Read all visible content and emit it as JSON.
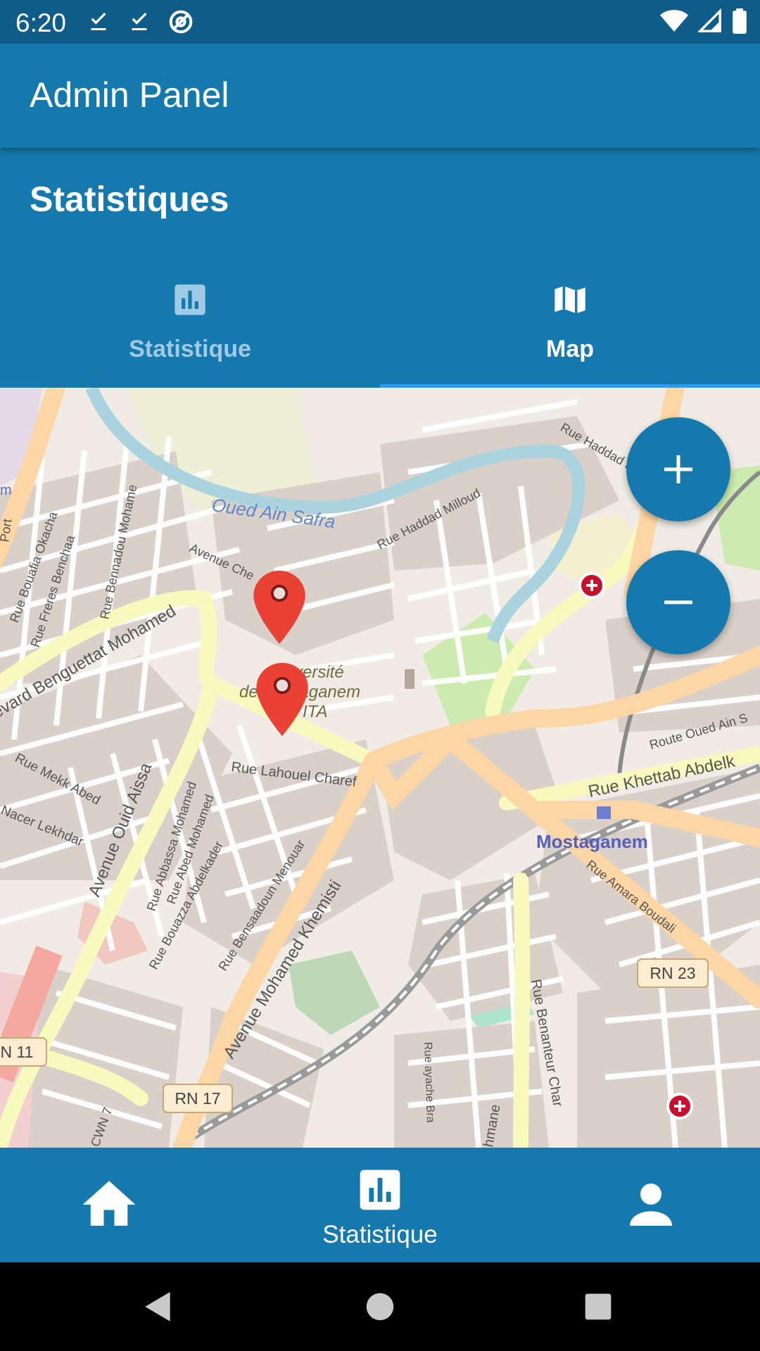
{
  "status_bar": {
    "time": "6:20",
    "left_icons": [
      "download-done-icon",
      "download-done-icon",
      "at-sign-icon"
    ],
    "right_icons": [
      "wifi-icon",
      "cell-signal-icon",
      "battery-icon"
    ]
  },
  "app_bar": {
    "title": "Admin Panel"
  },
  "section": {
    "title": "Statistiques"
  },
  "tabs": [
    {
      "label": "Statistique",
      "icon": "bar-chart-icon",
      "selected": false
    },
    {
      "label": "Map",
      "icon": "map-icon",
      "selected": true
    }
  ],
  "map": {
    "zoom_in_label": "+",
    "zoom_out_label": "−",
    "markers": 2,
    "labels": {
      "river": "Oued Ain Safra",
      "city": "Mostaganem",
      "university_1": "versité",
      "university_2": "de Mostaganem",
      "ita": "ITA",
      "road_rue_haddad_milloud": "Rue Haddad Milloud",
      "road_rue_haddad_milloud_2": "Rue Haddad Milloud",
      "road_avenue_che": "Avenue Che",
      "road_benguettat": "evard Benguettat Mohamed",
      "road_bennadou": "Rue Bennadou Mohame",
      "road_freres_benchaa": "Rue Freres Benchaa",
      "road_bouafia": "Rue Bouafia Okacha",
      "road_mekk_abed": "Rue Mekk Abed",
      "road_nacer_lekhdar": "Nacer Lekhdar",
      "road_ouid_aissa": "Avenue Ouid Aissa",
      "road_abbassa": "Rue Abbassa Mohamed",
      "road_abed_mohamed": "Rue Abed Mohamed",
      "road_bouazza": "Rue Bouazza Abdelkader",
      "road_bensaadoun": "Rue Bensaadoun Menouar",
      "road_lahouel": "Rue Lahouel Charef",
      "road_khemisti": "Avenue Mohamed Khemisti",
      "road_khettab": "Rue Khettab Abdelk",
      "road_oued_ain": "Route Oued Ain S",
      "road_amara": "Rue Amara Boudali",
      "road_benanteur": "Rue Benanteur Char",
      "road_ayache": "Rue ayache Bra",
      "road_hmane": "hmane",
      "road_cwn": "CWN 7",
      "road_port": "Port",
      "rn23": "RN 23",
      "rn17": "RN 17",
      "rn11": "N 11",
      "edge_m": "m"
    }
  },
  "bottom_nav": [
    {
      "icon": "home-icon",
      "label": ""
    },
    {
      "icon": "bar-chart-icon",
      "label": "Statistique"
    },
    {
      "icon": "person-icon",
      "label": ""
    }
  ],
  "system_nav": [
    "back-icon",
    "home-circle-icon",
    "recents-icon"
  ],
  "colors": {
    "primary": "#1679ad",
    "status_bar": "#0f5c88",
    "accent_indicator": "#2a9cf0",
    "marker": "#e94235"
  }
}
